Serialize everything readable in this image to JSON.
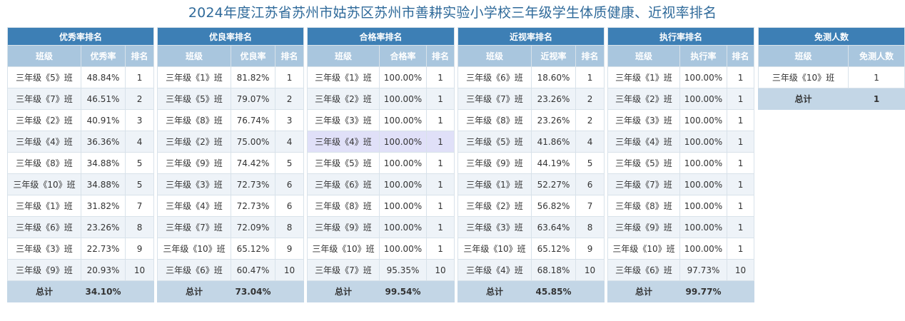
{
  "title": "2024年度江苏省苏州市姑苏区苏州市善耕实验小学校三年级学生体质健康、近视率排名",
  "tables": [
    {
      "id": "excellent",
      "title": "优秀率排名",
      "columns": [
        "班级",
        "优秀率",
        "排名"
      ],
      "rows": [
        [
          "三年级《5》班",
          "48.84%",
          "1"
        ],
        [
          "三年级《7》班",
          "46.51%",
          "2"
        ],
        [
          "三年级《2》班",
          "40.91%",
          "3"
        ],
        [
          "三年级《4》班",
          "36.36%",
          "4"
        ],
        [
          "三年级《8》班",
          "34.88%",
          "5"
        ],
        [
          "三年级《10》班",
          "34.88%",
          "5"
        ],
        [
          "三年级《1》班",
          "31.82%",
          "7"
        ],
        [
          "三年级《6》班",
          "23.26%",
          "8"
        ],
        [
          "三年级《3》班",
          "22.73%",
          "9"
        ],
        [
          "三年级《9》班",
          "20.93%",
          "10"
        ]
      ],
      "total": [
        "总计",
        "34.10%",
        ""
      ]
    },
    {
      "id": "good",
      "title": "优良率排名",
      "columns": [
        "班级",
        "优良率",
        "排名"
      ],
      "rows": [
        [
          "三年级《1》班",
          "81.82%",
          "1"
        ],
        [
          "三年级《5》班",
          "79.07%",
          "2"
        ],
        [
          "三年级《8》班",
          "76.74%",
          "3"
        ],
        [
          "三年级《2》班",
          "75.00%",
          "4"
        ],
        [
          "三年级《9》班",
          "74.42%",
          "5"
        ],
        [
          "三年级《3》班",
          "72.73%",
          "6"
        ],
        [
          "三年级《4》班",
          "72.73%",
          "6"
        ],
        [
          "三年级《7》班",
          "72.09%",
          "8"
        ],
        [
          "三年级《10》班",
          "65.12%",
          "9"
        ],
        [
          "三年级《6》班",
          "60.47%",
          "10"
        ]
      ],
      "total": [
        "总计",
        "73.04%",
        ""
      ]
    },
    {
      "id": "pass",
      "title": "合格率排名",
      "columns": [
        "班级",
        "合格率",
        "排名"
      ],
      "rows": [
        [
          "三年级《1》班",
          "100.00%",
          "1"
        ],
        [
          "三年级《2》班",
          "100.00%",
          "1"
        ],
        [
          "三年级《3》班",
          "100.00%",
          "1"
        ],
        [
          "三年级《4》班",
          "100.00%",
          "1"
        ],
        [
          "三年级《5》班",
          "100.00%",
          "1"
        ],
        [
          "三年级《6》班",
          "100.00%",
          "1"
        ],
        [
          "三年级《8》班",
          "100.00%",
          "1"
        ],
        [
          "三年级《9》班",
          "100.00%",
          "1"
        ],
        [
          "三年级《10》班",
          "100.00%",
          "1"
        ],
        [
          "三年级《7》班",
          "95.35%",
          "10"
        ]
      ],
      "total": [
        "总计",
        "99.54%",
        ""
      ],
      "highlight_row": 3
    },
    {
      "id": "myopia",
      "title": "近视率排名",
      "columns": [
        "班级",
        "近视率",
        "排名"
      ],
      "rows": [
        [
          "三年级《6》班",
          "18.60%",
          "1"
        ],
        [
          "三年级《7》班",
          "23.26%",
          "2"
        ],
        [
          "三年级《8》班",
          "23.26%",
          "2"
        ],
        [
          "三年级《5》班",
          "41.86%",
          "4"
        ],
        [
          "三年级《9》班",
          "44.19%",
          "5"
        ],
        [
          "三年级《1》班",
          "52.27%",
          "6"
        ],
        [
          "三年级《2》班",
          "56.82%",
          "7"
        ],
        [
          "三年级《3》班",
          "63.64%",
          "8"
        ],
        [
          "三年级《10》班",
          "65.12%",
          "9"
        ],
        [
          "三年级《4》班",
          "68.18%",
          "10"
        ]
      ],
      "total": [
        "总计",
        "45.85%",
        ""
      ]
    },
    {
      "id": "execution",
      "title": "执行率排名",
      "columns": [
        "班级",
        "执行率",
        "排名"
      ],
      "rows": [
        [
          "三年级《1》班",
          "100.00%",
          "1"
        ],
        [
          "三年级《2》班",
          "100.00%",
          "1"
        ],
        [
          "三年级《3》班",
          "100.00%",
          "1"
        ],
        [
          "三年级《4》班",
          "100.00%",
          "1"
        ],
        [
          "三年级《5》班",
          "100.00%",
          "1"
        ],
        [
          "三年级《7》班",
          "100.00%",
          "1"
        ],
        [
          "三年级《8》班",
          "100.00%",
          "1"
        ],
        [
          "三年级《9》班",
          "100.00%",
          "1"
        ],
        [
          "三年级《10》班",
          "100.00%",
          "1"
        ],
        [
          "三年级《6》班",
          "97.73%",
          "10"
        ]
      ],
      "total": [
        "总计",
        "99.77%",
        ""
      ]
    },
    {
      "id": "exempt",
      "title": "免测人数",
      "columns": [
        "班级",
        "免测人数"
      ],
      "rows": [
        [
          "三年级《10》班",
          "1"
        ]
      ],
      "total": [
        "总计",
        "1"
      ]
    }
  ]
}
